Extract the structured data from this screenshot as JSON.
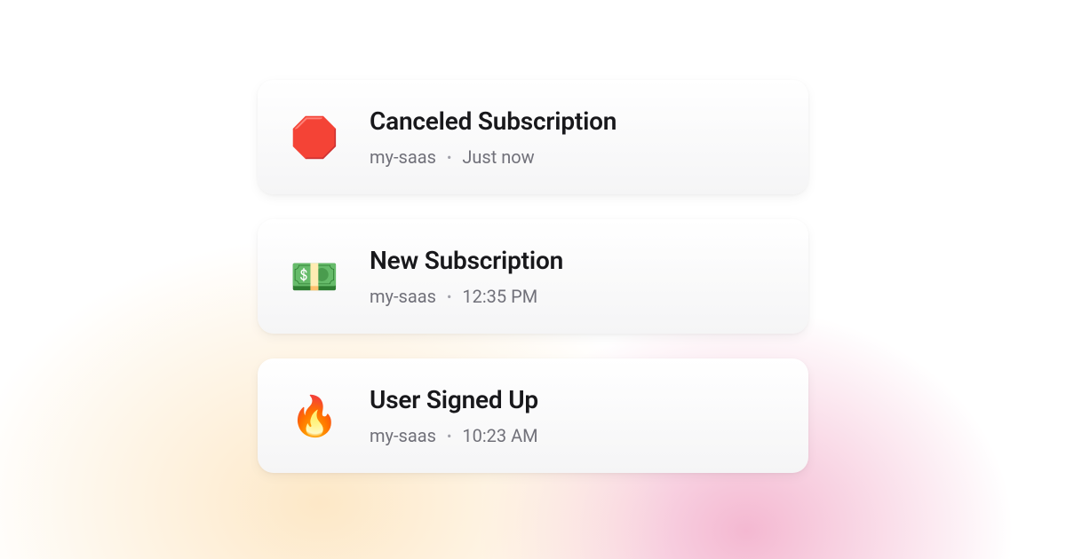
{
  "notifications": [
    {
      "icon": "🛑",
      "iconName": "stop-sign-icon",
      "title": "Canceled Subscription",
      "source": "my-saas",
      "time": "Just now"
    },
    {
      "icon": "💵",
      "iconName": "money-icon",
      "title": "New Subscription",
      "source": "my-saas",
      "time": "12:35 PM"
    },
    {
      "icon": "🔥",
      "iconName": "fire-icon",
      "title": "User Signed Up",
      "source": "my-saas",
      "time": "10:23 AM"
    }
  ],
  "separator": "•"
}
